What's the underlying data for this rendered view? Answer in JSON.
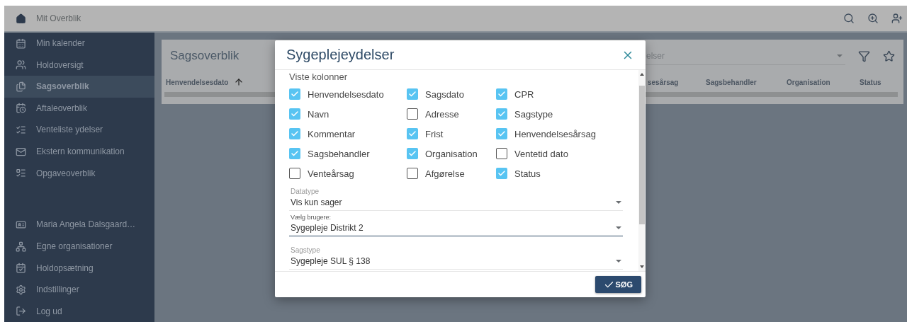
{
  "header": {
    "home": "Mit Overblik"
  },
  "sidebar": {
    "nav": [
      {
        "label": "Min kalender",
        "selected": false
      },
      {
        "label": "Holdoversigt",
        "selected": false
      },
      {
        "label": "Sagsoverblik",
        "selected": true
      },
      {
        "label": "Aftaleoverblik",
        "selected": false
      },
      {
        "label": "Venteliste ydelser",
        "selected": false
      },
      {
        "label": "Ekstern kommunikation",
        "selected": false
      },
      {
        "label": "Opgaveoverblik",
        "selected": false
      }
    ],
    "account": [
      {
        "label": "Maria Angela Dalsgaard…",
        "selected": false
      },
      {
        "label": "Egne organisationer",
        "selected": false
      },
      {
        "label": "Holdopsætning",
        "selected": false
      },
      {
        "label": "Indstillinger",
        "selected": false
      },
      {
        "label": "Log ud",
        "selected": false
      }
    ]
  },
  "card": {
    "title": "Sagsoverblik",
    "select_value": "elser",
    "columns": [
      {
        "label": "Henvendelsesdato",
        "sorted": true
      },
      {
        "label": "sesårsag",
        "sorted": false
      },
      {
        "label": "Sagsbehandler",
        "sorted": false
      },
      {
        "label": "Organisation",
        "sorted": false
      },
      {
        "label": "Status",
        "sorted": false
      }
    ]
  },
  "dialog": {
    "title": "Sygeplejeydelser",
    "section_label": "Viste kolonner",
    "options": [
      {
        "label": "Henvendelsesdato",
        "checked": true
      },
      {
        "label": "Sagsdato",
        "checked": true
      },
      {
        "label": "CPR",
        "checked": true
      },
      {
        "label": "Navn",
        "checked": true
      },
      {
        "label": "Adresse",
        "checked": false
      },
      {
        "label": "Sagstype",
        "checked": true
      },
      {
        "label": "Kommentar",
        "checked": true
      },
      {
        "label": "Frist",
        "checked": true
      },
      {
        "label": "Henvendelsesårsag",
        "checked": true
      },
      {
        "label": "Sagsbehandler",
        "checked": true
      },
      {
        "label": "Organisation",
        "checked": true
      },
      {
        "label": "Ventetid dato",
        "checked": false
      },
      {
        "label": "Venteårsag",
        "checked": false
      },
      {
        "label": "Afgørelse",
        "checked": false
      },
      {
        "label": "Status",
        "checked": true
      }
    ],
    "fields": [
      {
        "label": "Datatype",
        "value": "Vis kun sager",
        "focused": false
      },
      {
        "label": "Vælg brugere:",
        "value": "Sygepleje Distrikt 2",
        "focused": true
      },
      {
        "label": "Sagstype",
        "value": "Sygepleje SUL § 138",
        "focused": false
      }
    ],
    "button": "SØG"
  }
}
